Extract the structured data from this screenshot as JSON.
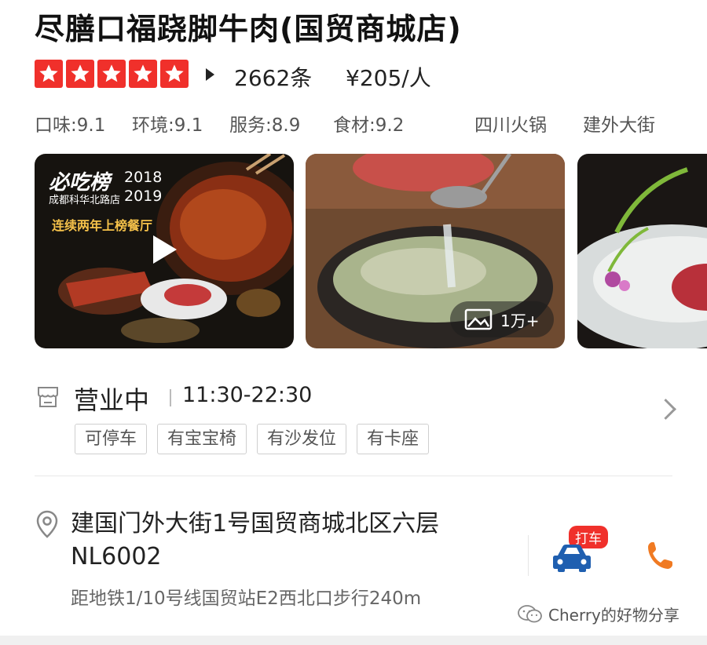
{
  "header": {
    "title": "尽膳口福跷脚牛肉(国贸商城店)",
    "rating_stars": 5,
    "reviews": "2662条",
    "price": "¥205/人"
  },
  "scores": {
    "taste": "口味:9.1",
    "environment": "环境:9.1",
    "service": "服务:8.9",
    "ingredients": "食材:9.2",
    "cuisine": "四川火锅",
    "area": "建外大街"
  },
  "photos": {
    "promo_brand": "必吃榜",
    "promo_year1": "2018",
    "promo_year2": "2019",
    "promo_branch": "成都科华北路店",
    "promo_caption": "连续两年上榜餐厅",
    "photo_count": "1万+"
  },
  "hours": {
    "status": "营业中",
    "time": "11:30-22:30"
  },
  "tags": [
    "可停车",
    "有宝宝椅",
    "有沙发位",
    "有卡座"
  ],
  "address": {
    "line": "建国门外大街1号国贸商城北区六层NL6002",
    "metro": "距地铁1/10号线国贸站E2西北口步行240m",
    "taxi_label": "打车"
  },
  "watermark": "Cherry的好物分享",
  "colors": {
    "accent_red": "#f0302b",
    "taxi_blue": "#1f5fb0",
    "phone_orange": "#f07a22"
  },
  "icons": [
    "star-icon",
    "shop-icon",
    "chevron-right-icon",
    "location-pin-icon",
    "car-icon",
    "phone-icon",
    "image-icon",
    "play-icon",
    "wechat-icon"
  ]
}
